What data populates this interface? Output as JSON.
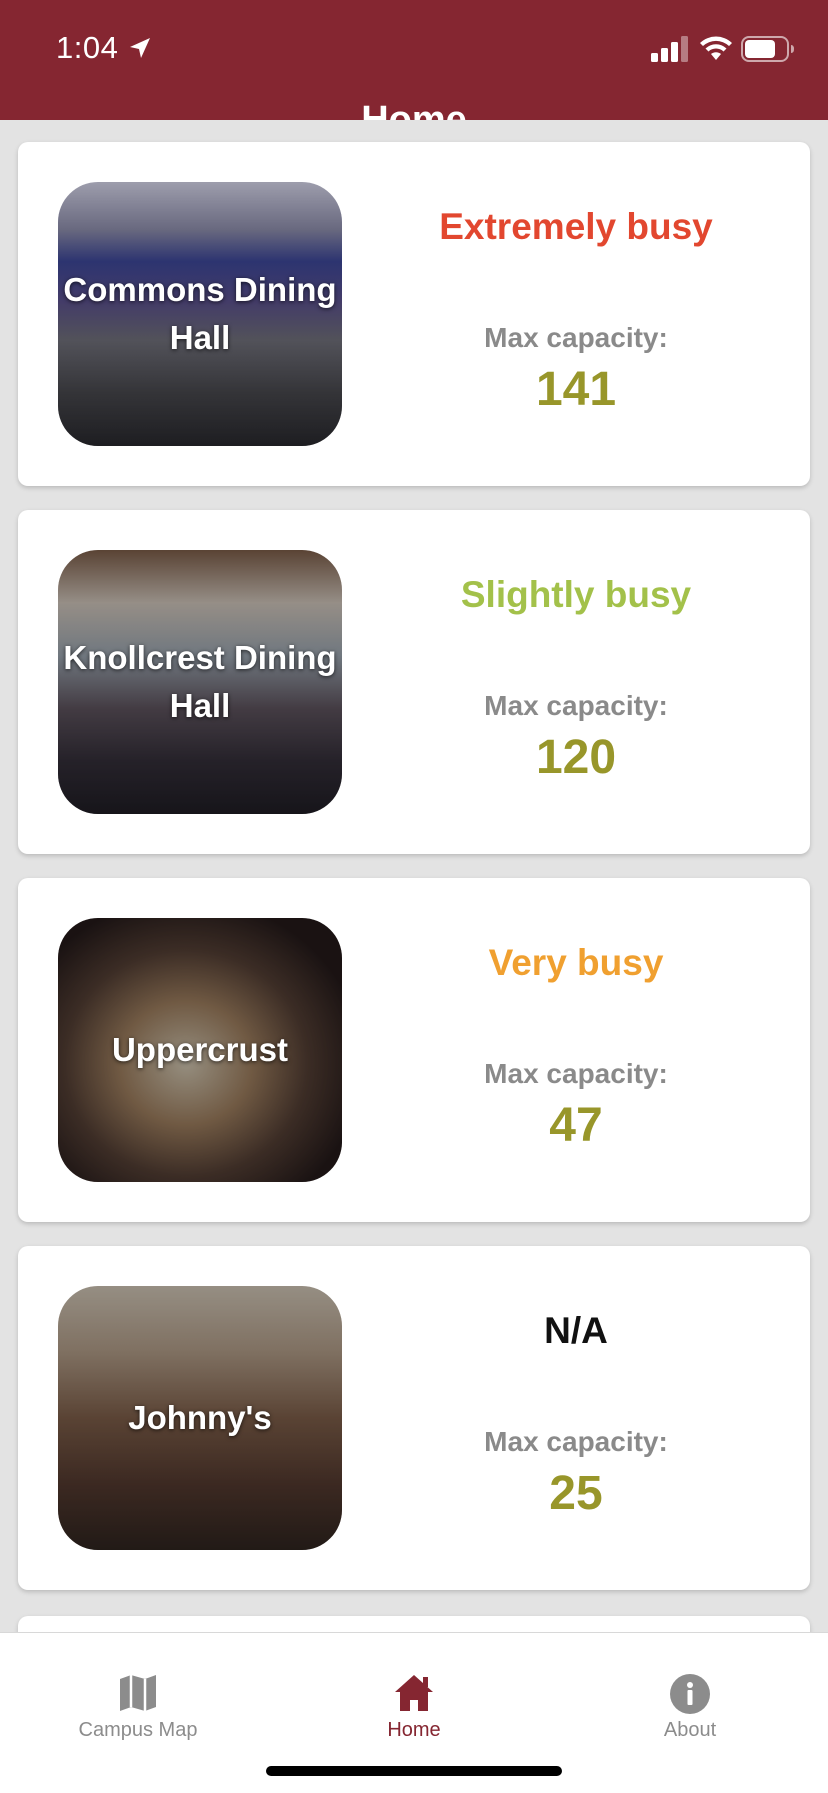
{
  "status_bar": {
    "time": "1:04"
  },
  "header": {
    "title": "Home"
  },
  "colors": {
    "brand": "#852631",
    "extremely_busy": "#e2472f",
    "slightly_busy": "#a3c14a",
    "very_busy": "#f0a030",
    "na": "#111111",
    "capacity_value": "#98962a"
  },
  "locations": [
    {
      "name": "Commons Dining Hall",
      "status": "Extremely busy",
      "capacity_label": "Max capacity:",
      "capacity": "141"
    },
    {
      "name": "Knollcrest Dining Hall",
      "status": "Slightly busy",
      "capacity_label": "Max capacity:",
      "capacity": "120"
    },
    {
      "name": "Uppercrust",
      "status": "Very busy",
      "capacity_label": "Max capacity:",
      "capacity": "47"
    },
    {
      "name": "Johnny's",
      "status": "N/A",
      "capacity_label": "Max capacity:",
      "capacity": "25"
    }
  ],
  "tabs": [
    {
      "label": "Campus Map",
      "icon": "map-icon",
      "active": false
    },
    {
      "label": "Home",
      "icon": "home-icon",
      "active": true
    },
    {
      "label": "About",
      "icon": "info-icon",
      "active": false
    }
  ]
}
